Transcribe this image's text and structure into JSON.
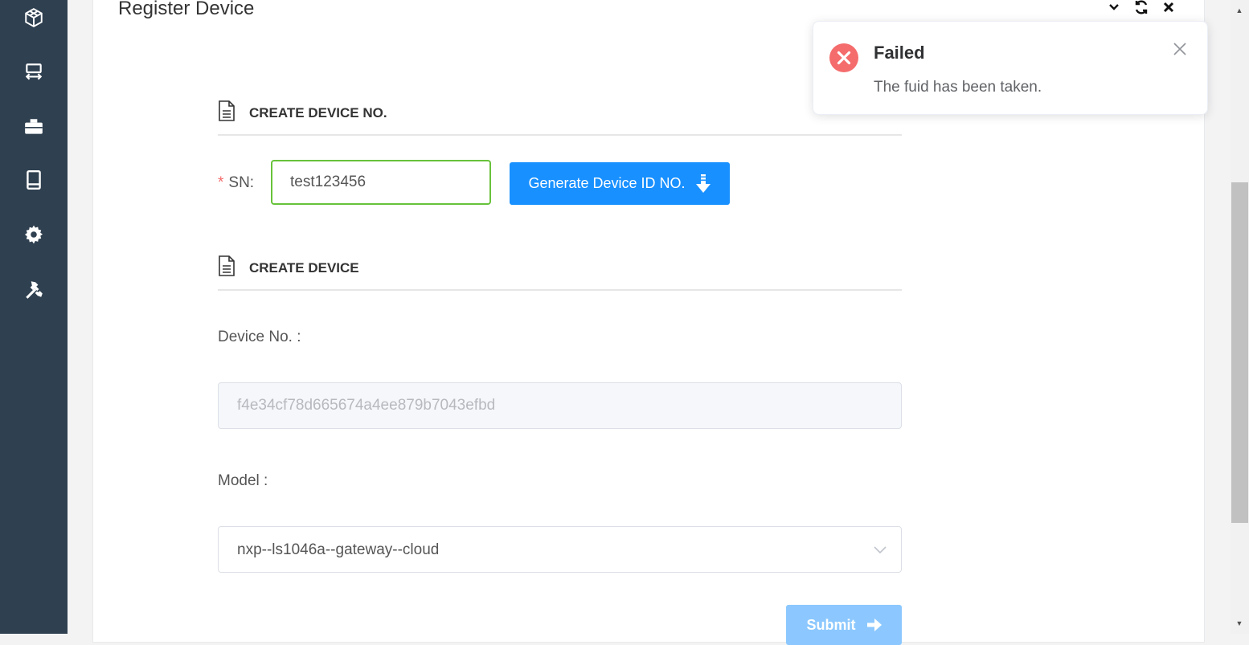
{
  "sidebar": {
    "icons": [
      "cube-icon",
      "server-transfer-icon",
      "briefcase-icon",
      "tablet-icon",
      "gear-icon",
      "tools-icon"
    ]
  },
  "panel": {
    "title": "Register Device",
    "tools": [
      "chevron-down-icon",
      "refresh-icon",
      "close-icon"
    ]
  },
  "sections": {
    "create_no": "CREATE DEVICE NO.",
    "create_device": "CREATE DEVICE"
  },
  "form": {
    "sn_required_mark": "*",
    "sn_label": "SN:",
    "sn_value": "test123456",
    "generate_label": "Generate Device ID NO.",
    "device_no_label": "Device No. :",
    "device_no_value": "f4e34cf78d665674a4ee879b7043efbd",
    "model_label": "Model :",
    "model_value": "nxp--ls1046a--gateway--cloud",
    "submit_label": "Submit"
  },
  "toast": {
    "title": "Failed",
    "message": "The fuid has been taken."
  },
  "colors": {
    "sidebar": "#2f4050",
    "primary": "#1890ff",
    "submit_disabled": "#8cc8ff",
    "success_border": "#67c23a",
    "error": "#f56c6c"
  }
}
